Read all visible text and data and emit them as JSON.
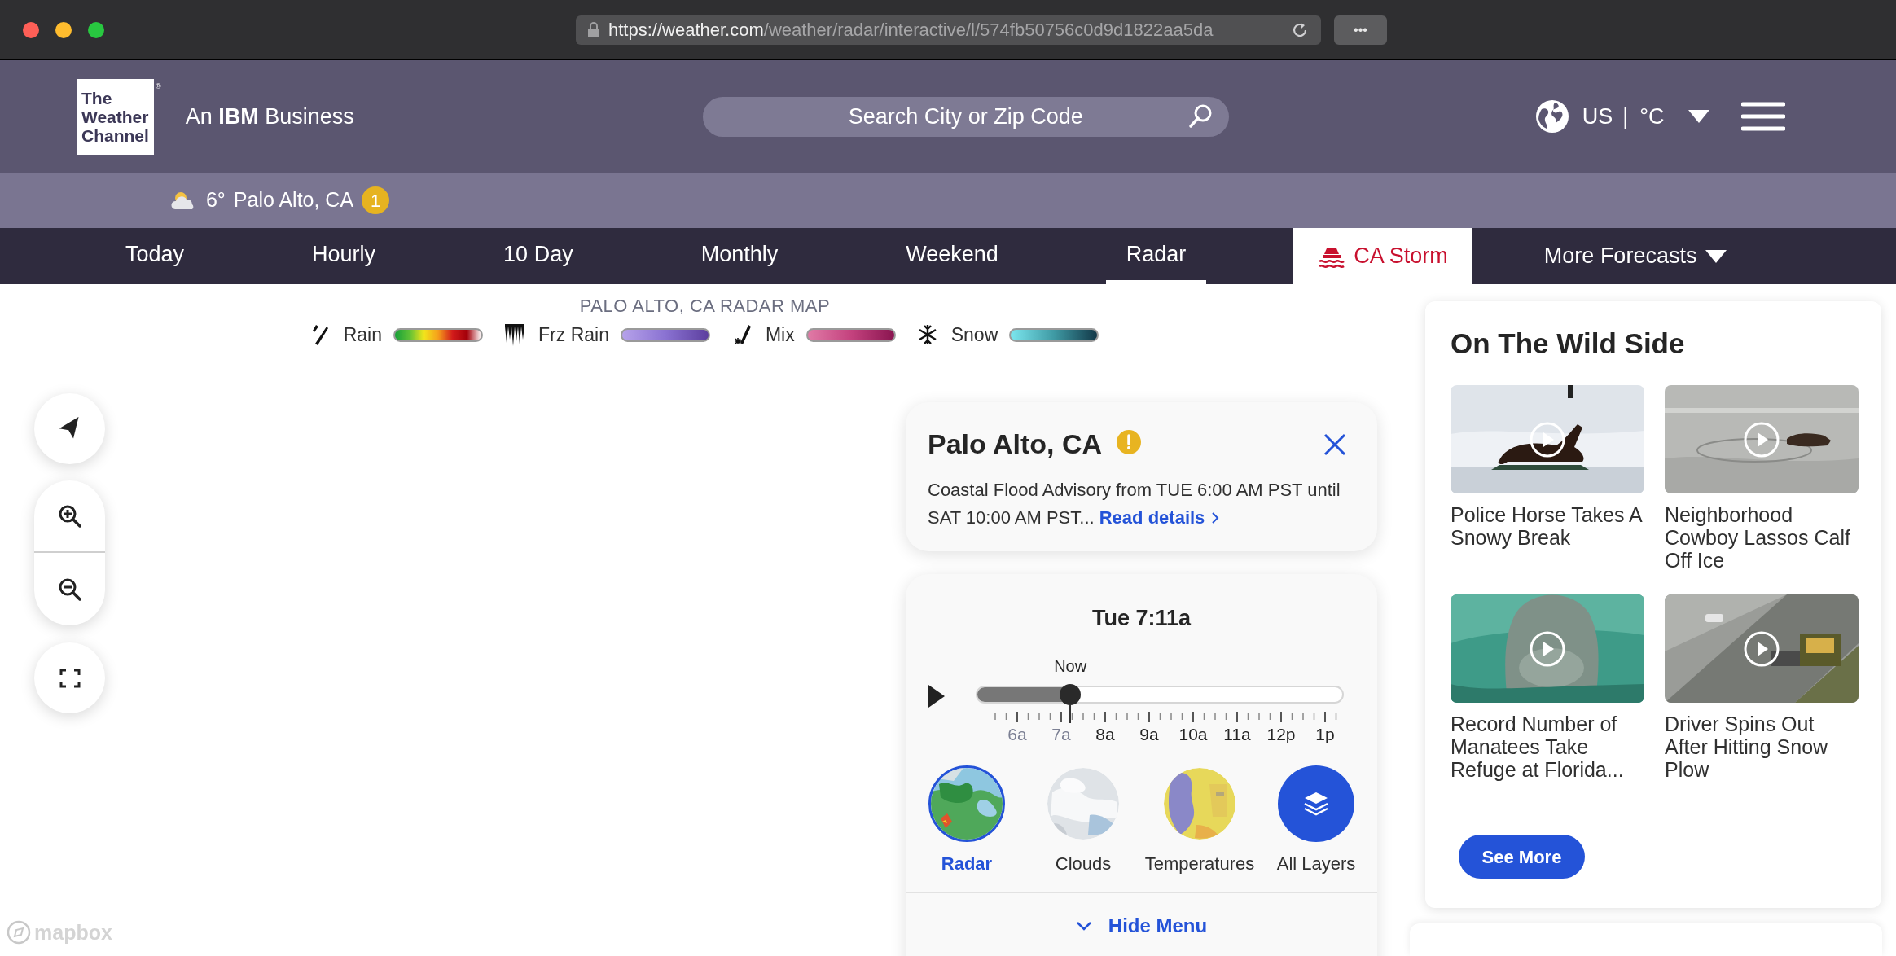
{
  "browser": {
    "url_host": "https://weather.com",
    "url_path": "/weather/radar/interactive/l/574fb50756c0d9d1822aa5da",
    "more_button": "•••"
  },
  "header": {
    "logo_lines": [
      "The",
      "Weather",
      "Channel"
    ],
    "logo_mark": "®",
    "tagline": "An **IBM** Business",
    "search": {
      "placeholder": "Search City or Zip Code"
    },
    "region": "US",
    "separator": "|",
    "unit": "°C"
  },
  "location_bar": {
    "temperature": "6°",
    "location": "Palo Alto, CA",
    "alert_count": "1"
  },
  "tabs": [
    {
      "label": "Today",
      "kind": "tab",
      "selected": false
    },
    {
      "label": "Hourly",
      "kind": "tab",
      "selected": false
    },
    {
      "label": "10 Day",
      "kind": "tab",
      "selected": false
    },
    {
      "label": "Monthly",
      "kind": "tab",
      "selected": false
    },
    {
      "label": "Weekend",
      "kind": "tab",
      "selected": false
    },
    {
      "label": "Radar",
      "kind": "tab",
      "selected": true
    },
    {
      "label": "CA Storm",
      "kind": "storm",
      "selected": false
    },
    {
      "label": "More Forecasts",
      "kind": "menu",
      "selected": false
    }
  ],
  "map": {
    "legend_title": "PALO ALTO, CA RADAR MAP",
    "legend": [
      {
        "label": "Rain",
        "kind": "rain"
      },
      {
        "label": "Frz Rain",
        "kind": "frz_rain"
      },
      {
        "label": "Mix",
        "kind": "mix"
      },
      {
        "label": "Snow",
        "kind": "snow"
      }
    ],
    "attribution": "mapbox"
  },
  "alert": {
    "title": "Palo Alto, CA",
    "text": "Coastal Flood Advisory from TUE 6:00 AM PST until SAT 10:00 AM PST...",
    "link": "Read details"
  },
  "timeline": {
    "time": "Tue 7:11a",
    "marker_label": "Now",
    "level": 0.257,
    "ticks": [
      {
        "label": "6a",
        "past": true
      },
      {
        "label": "7a",
        "past": true
      },
      {
        "label": "8a",
        "past": false
      },
      {
        "label": "9a",
        "past": false
      },
      {
        "label": "10a",
        "past": false
      },
      {
        "label": "11a",
        "past": false
      },
      {
        "label": "12p",
        "past": false
      },
      {
        "label": "1p",
        "past": false
      }
    ],
    "layers": [
      {
        "label": "Radar",
        "kind": "picture",
        "selected": true
      },
      {
        "label": "Clouds",
        "kind": "picture",
        "selected": false
      },
      {
        "label": "Temperatures",
        "kind": "picture",
        "selected": false
      },
      {
        "label": "All Layers",
        "kind": "icon",
        "selected": false
      }
    ],
    "hide_menu": "Hide Menu"
  },
  "wild_side": {
    "title": "On The Wild Side",
    "videos": [
      {
        "title": "Police Horse Takes A Snowy Break"
      },
      {
        "title": "Neighborhood Cowboy Lassos Calf Off Ice"
      },
      {
        "title": "Record Number of Manatees Take Refuge at Florida..."
      },
      {
        "title": "Driver Spins Out After Hitting Snow Plow"
      }
    ],
    "button": "See More"
  }
}
